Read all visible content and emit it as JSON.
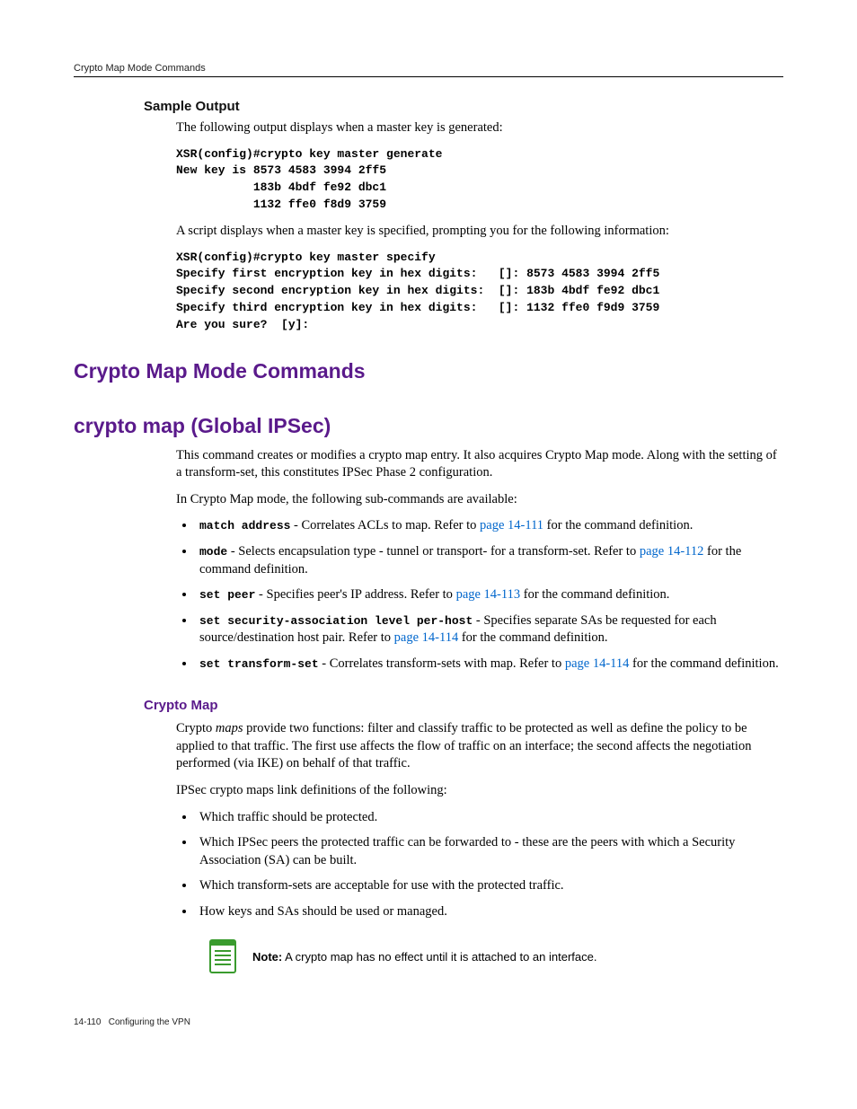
{
  "running_header": "Crypto Map Mode Commands",
  "sample_output": {
    "heading": "Sample Output",
    "intro": "The following output displays when a master key is generated:",
    "block1_html": "XSR(config)#crypto key master generate\nNew key is 8573 4583 3994 2ff5\n           183b 4bdf fe92 dbc1\n           1132 ffe0 f8d9 3759",
    "mid": "A script displays when a master key is specified, prompting you for the following information:",
    "block2_html": "XSR(config)#crypto key master specify\nSpecify first encryption key in hex digits:   []: 8573 4583 3994 2ff5\nSpecify second encryption key in hex digits:  []: 183b 4bdf fe92 dbc1\nSpecify third encryption key in hex digits:   []: 1132 ffe0 f9d9 3759\nAre you sure?  [y]:"
  },
  "section1": {
    "title": "Crypto Map Mode Commands"
  },
  "section2": {
    "title": "crypto map (Global IPSec)",
    "p1": "This command creates or modifies a crypto map entry. It also acquires Crypto Map mode. Along with the setting of a transform-set, this constitutes IPSec Phase 2 configuration.",
    "p2": "In Crypto Map mode, the following sub-commands are available:",
    "items": {
      "i1_code": "match address",
      "i1_text": " - Correlates ACLs to map. Refer to ",
      "i1_link": "page 14-111",
      "i1_tail": " for the command definition.",
      "i2_code": "mode",
      "i2_text": " - Selects encapsulation type - tunnel or transport- for a transform-set. Refer to ",
      "i2_link": "page 14-112",
      "i2_tail": " for the command definition.",
      "i3_code": "set peer",
      "i3_text": " - Specifies peer's IP address. Refer to ",
      "i3_link": "page 14-113",
      "i3_tail": " for the command definition.",
      "i4_code": "set security-association level per-host",
      "i4_text": " - Specifies separate SAs be requested for each source/destination host pair. Refer to ",
      "i4_link": "page 14-114",
      "i4_tail": " for the command definition.",
      "i5_code": "set transform-set",
      "i5_text": " - Correlates transform-sets with map. Refer to ",
      "i5_link": "page 14-114",
      "i5_tail": " for the command definition."
    }
  },
  "crypto_map": {
    "heading": "Crypto Map",
    "p1_pre": "Crypto ",
    "p1_ital": "maps",
    "p1_post": " provide two functions: filter and classify traffic to be protected as well as define the policy to be applied to that traffic. The first use affects the flow of traffic on an interface; the second affects the negotiation performed (via IKE) on behalf of that traffic.",
    "p2": "IPSec crypto maps link definitions of the following:",
    "b1": "Which traffic should be protected.",
    "b2": "Which IPSec peers the protected traffic can be forwarded to - these are the peers with which a Security Association (SA) can be built.",
    "b3": "Which transform-sets are acceptable for use with the protected traffic.",
    "b4": "How keys and SAs should be used or managed."
  },
  "note": {
    "label": "Note:",
    "text": " A crypto map has no effect until it is attached to an interface."
  },
  "footer": {
    "page": "14-110",
    "title": "Configuring the VPN"
  }
}
